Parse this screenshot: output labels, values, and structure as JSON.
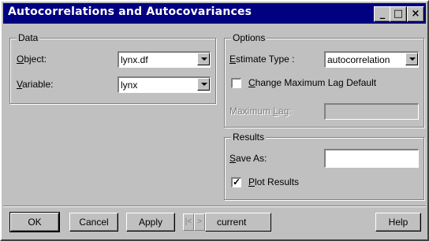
{
  "window": {
    "title": "Autocorrelations and Autocovariances",
    "controls": [
      "_",
      "□",
      "×"
    ]
  },
  "data_group": {
    "label": "Data",
    "object": {
      "label_u": "O",
      "label_rest": "bject:",
      "value": "lynx.df"
    },
    "variable": {
      "label_u": "V",
      "label_rest": "ariable:",
      "value": "lynx"
    }
  },
  "options_group": {
    "label": "Options",
    "estimate_type": {
      "label_u": "E",
      "label_rest": "stimate Type :",
      "value": "autocorrelation"
    },
    "change_max_lag": {
      "label_u": "C",
      "label_rest": "hange Maximum Lag Default",
      "checked": false
    },
    "maximum_lag": {
      "label_pre": "Maximum ",
      "label_u": "L",
      "label_rest": "ag:",
      "value": ""
    }
  },
  "results_group": {
    "label": "Results",
    "save_as": {
      "label_u": "S",
      "label_rest": "ave As:",
      "value": ""
    },
    "plot_results": {
      "label_u": "P",
      "label_rest": "lot Results",
      "checked": true,
      "mark": "✓"
    }
  },
  "buttons": {
    "ok": "OK",
    "cancel": "Cancel",
    "apply": "Apply",
    "prev": "|<",
    "next": ">",
    "current": "current",
    "help": "Help"
  }
}
